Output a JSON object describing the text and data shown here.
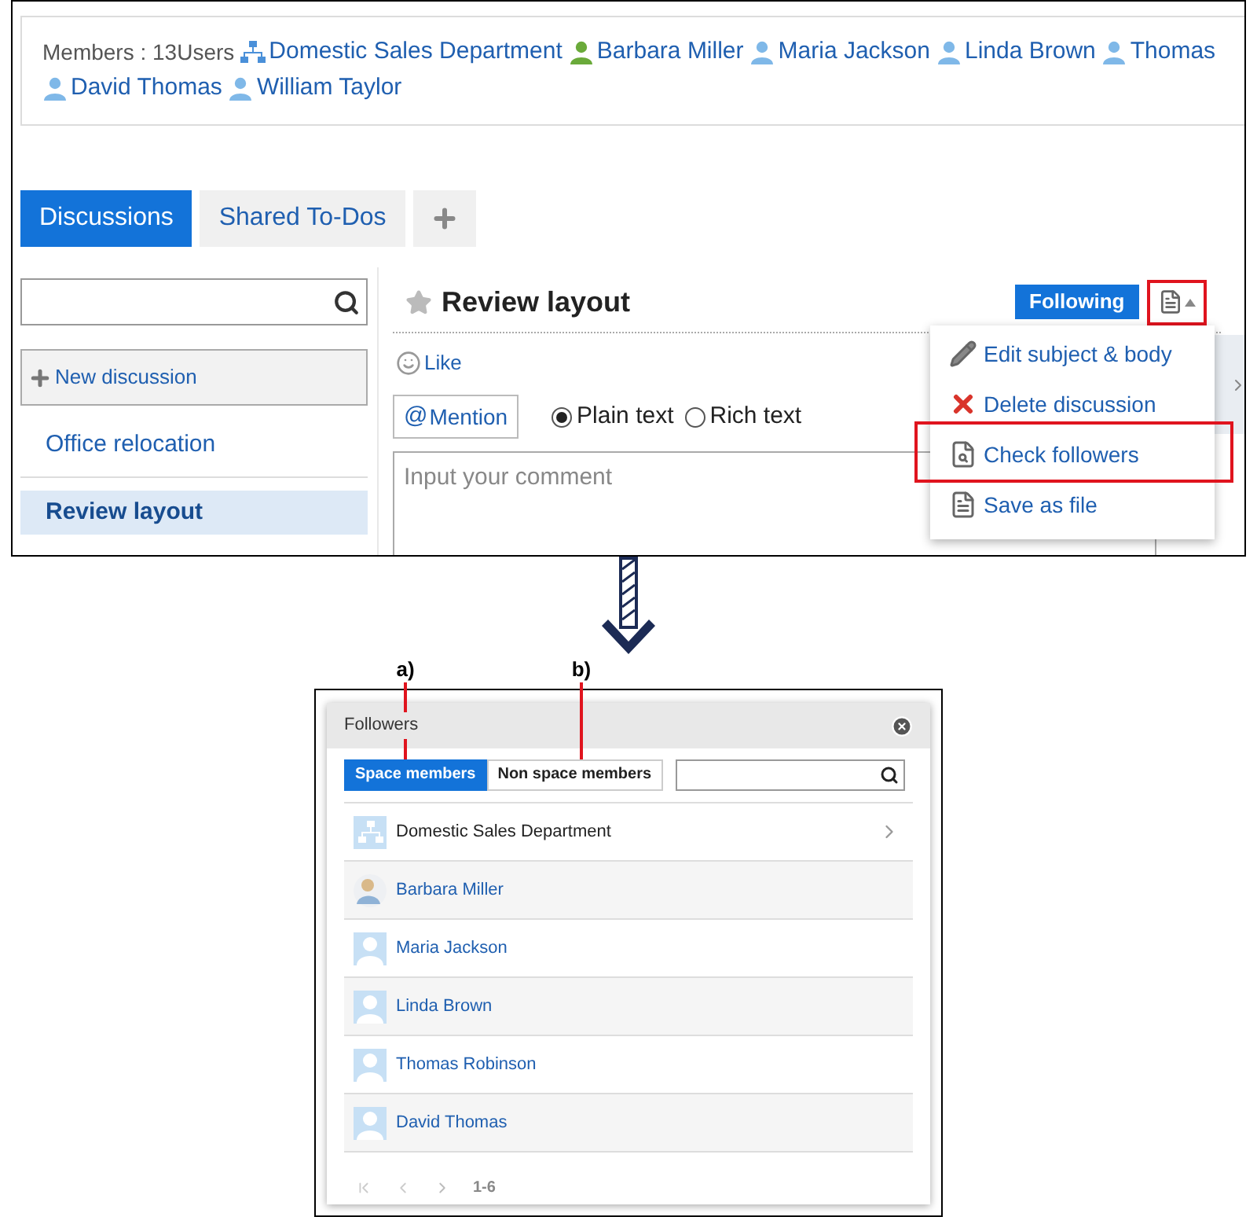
{
  "members_bar": {
    "label": "Members : 13Users",
    "members": [
      {
        "kind": "org",
        "name": "Domestic Sales Department",
        "color": "#4a90d9"
      },
      {
        "kind": "user",
        "name": "Barbara Miller",
        "color": "#6aaa3a"
      },
      {
        "kind": "user",
        "name": "Maria Jackson",
        "color": "#7fb8e8"
      },
      {
        "kind": "user",
        "name": "Linda Brown",
        "color": "#7fb8e8"
      },
      {
        "kind": "user",
        "name": "Thomas",
        "color": "#7fb8e8"
      },
      {
        "kind": "user",
        "name": "David Thomas",
        "color": "#7fb8e8"
      },
      {
        "kind": "user",
        "name": "William Taylor",
        "color": "#7fb8e8"
      }
    ]
  },
  "tabs": [
    {
      "label": "Discussions",
      "selected": true
    },
    {
      "label": "Shared To-Dos",
      "selected": false
    }
  ],
  "sidebar": {
    "new_button": "New discussion",
    "items": [
      {
        "label": "Office relocation",
        "selected": false
      },
      {
        "label": "Review layout",
        "selected": true
      }
    ]
  },
  "discussion": {
    "title": "Review layout",
    "starred": false,
    "follow_button": "Following",
    "like": "Like",
    "mention_icon": "@",
    "mention": "Mention",
    "format_options": [
      {
        "label": "Plain text",
        "selected": true
      },
      {
        "label": "Rich text",
        "selected": false
      }
    ],
    "comment": {
      "placeholder": "Input your comment"
    }
  },
  "menu": {
    "items": [
      {
        "kind": "edit",
        "label": "Edit subject & body",
        "highlighted": false
      },
      {
        "kind": "delete",
        "label": "Delete discussion",
        "highlighted": false
      },
      {
        "kind": "followers",
        "label": "Check followers",
        "highlighted": true
      },
      {
        "kind": "save",
        "label": "Save as file",
        "highlighted": false
      }
    ]
  },
  "callouts": [
    {
      "label": "a)"
    },
    {
      "label": "b)"
    }
  ],
  "followers_dialog": {
    "title": "Followers",
    "tabs": [
      {
        "label": "Space members",
        "selected": true
      },
      {
        "label": "Non space members",
        "selected": false
      }
    ],
    "rows": [
      {
        "kind": "org",
        "name": "Domestic Sales Department"
      },
      {
        "kind": "photo",
        "name": "Barbara Miller"
      },
      {
        "kind": "user",
        "name": "Maria Jackson"
      },
      {
        "kind": "user",
        "name": "Linda Brown"
      },
      {
        "kind": "user",
        "name": "Thomas Robinson"
      },
      {
        "kind": "user",
        "name": "David Thomas"
      }
    ],
    "pager": "1-6"
  }
}
